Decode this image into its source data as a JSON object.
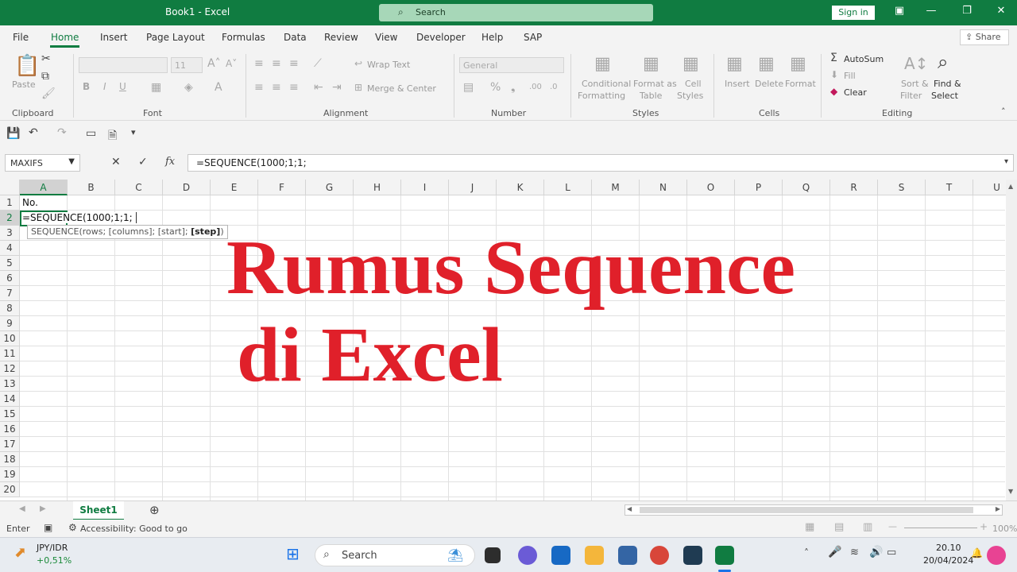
{
  "titlebar": {
    "doc_title": "Book1 - Excel",
    "search_placeholder": "Search",
    "signin": "Sign in"
  },
  "tabs": [
    {
      "label": "File",
      "active": false
    },
    {
      "label": "Home",
      "active": true
    },
    {
      "label": "Insert",
      "active": false
    },
    {
      "label": "Page Layout",
      "active": false
    },
    {
      "label": "Formulas",
      "active": false
    },
    {
      "label": "Data",
      "active": false
    },
    {
      "label": "Review",
      "active": false
    },
    {
      "label": "View",
      "active": false
    },
    {
      "label": "Developer",
      "active": false
    },
    {
      "label": "Help",
      "active": false
    },
    {
      "label": "SAP",
      "active": false
    }
  ],
  "share_label": "Share",
  "ribbon": {
    "clipboard": {
      "paste": "Paste",
      "group": "Clipboard"
    },
    "font": {
      "name": "",
      "size": "11",
      "group": "Font"
    },
    "alignment": {
      "wrap_text": "Wrap Text",
      "merge_center": "Merge & Center",
      "group": "Alignment"
    },
    "number": {
      "format": "General",
      "group": "Number"
    },
    "styles": {
      "conditional_1": "Conditional",
      "conditional_2": "Formatting",
      "format_as_1": "Format as",
      "format_as_2": "Table",
      "cell_1": "Cell",
      "cell_2": "Styles",
      "group": "Styles"
    },
    "cells": {
      "insert": "Insert",
      "delete": "Delete",
      "format": "Format",
      "group": "Cells"
    },
    "editing": {
      "autosum": "AutoSum",
      "fill": "Fill",
      "clear": "Clear",
      "sort_1": "Sort &",
      "sort_2": "Filter",
      "find_1": "Find &",
      "find_2": "Select",
      "group": "Editing"
    }
  },
  "formula_bar": {
    "name_box": "MAXIFS",
    "formula": "=SEQUENCE(1000;1;1;"
  },
  "columns": [
    "A",
    "B",
    "C",
    "D",
    "E",
    "F",
    "G",
    "H",
    "I",
    "J",
    "K",
    "L",
    "M",
    "N",
    "O",
    "P",
    "Q",
    "R",
    "S",
    "T",
    "U"
  ],
  "rows": [
    "1",
    "2",
    "3",
    "4",
    "5",
    "6",
    "7",
    "8",
    "9",
    "10",
    "11",
    "12",
    "13",
    "14",
    "15",
    "16",
    "17",
    "18",
    "19",
    "20"
  ],
  "cells": {
    "A1": "No.",
    "A2": "=SEQUENCE(1000;1;1;"
  },
  "tooltip": {
    "func": "SEQUENCE(rows; [columns]; [start]; ",
    "bold_arg": "[step]",
    "close": ")"
  },
  "overlay": {
    "line1": "Rumus Sequence",
    "line2": "di Excel"
  },
  "sheet_tab": "Sheet1",
  "status": {
    "mode": "Enter",
    "accessibility": "Accessibility: Good to go",
    "zoom": "100%"
  },
  "taskbar": {
    "ticker": "JPY/IDR",
    "ticker_change": "+0,51%",
    "search": "Search",
    "time": "20.10",
    "date": "20/04/2024"
  }
}
